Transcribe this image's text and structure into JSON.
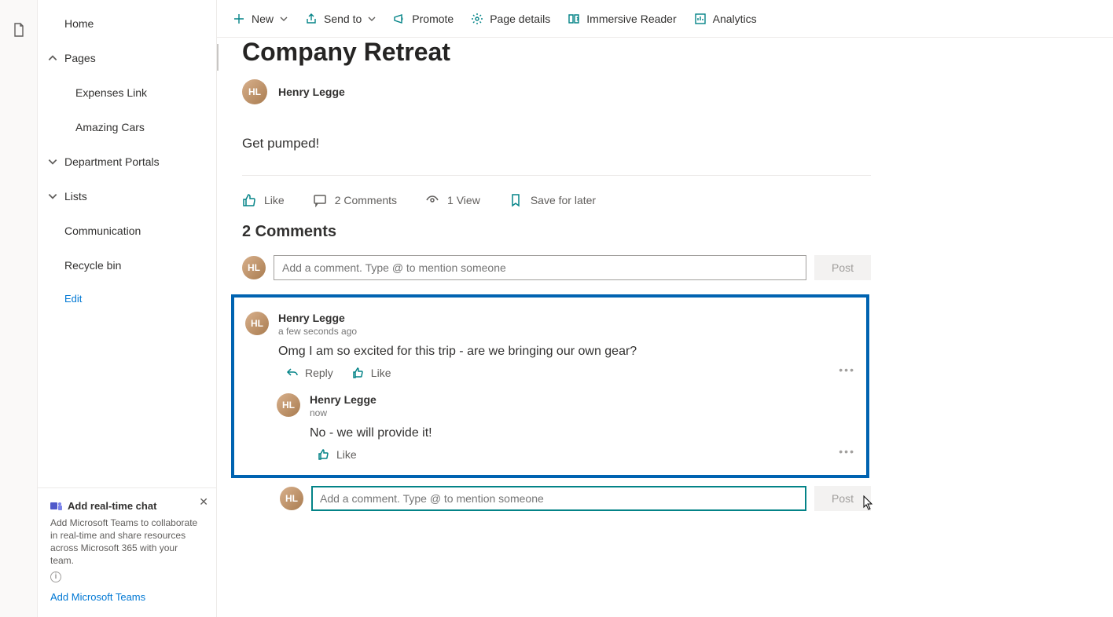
{
  "sidebar": {
    "home": "Home",
    "pages": "Pages",
    "expenses_link": "Expenses Link",
    "amazing_cars": "Amazing Cars",
    "department_portals": "Department Portals",
    "lists": "Lists",
    "communication": "Communication",
    "recycle_bin": "Recycle bin",
    "edit": "Edit"
  },
  "promo": {
    "title": "Add real-time chat",
    "desc": "Add Microsoft Teams to collaborate in real-time and share resources across Microsoft 365 with your team.",
    "link": "Add Microsoft Teams"
  },
  "commands": {
    "new": "New",
    "send_to": "Send to",
    "promote": "Promote",
    "page_details": "Page details",
    "immersive_reader": "Immersive Reader",
    "analytics": "Analytics"
  },
  "page": {
    "title": "Company Retreat",
    "author": "Henry Legge",
    "body": "Get pumped!"
  },
  "engagement": {
    "like": "Like",
    "comments": "2 Comments",
    "views": "1 View",
    "save": "Save for later"
  },
  "comments_section": {
    "header": "2 Comments",
    "placeholder": "Add a comment. Type @ to mention someone",
    "post": "Post",
    "reply_label": "Reply",
    "like_label": "Like",
    "comment1": {
      "author": "Henry Legge",
      "time": "a few seconds ago",
      "text": "Omg I am so excited for this trip - are we bringing our own gear?"
    },
    "comment2": {
      "author": "Henry Legge",
      "time": "now",
      "text": "No - we will provide it!"
    }
  },
  "colors": {
    "accent": "#038387",
    "link": "#0078d4",
    "highlight_border": "#0063b1"
  }
}
